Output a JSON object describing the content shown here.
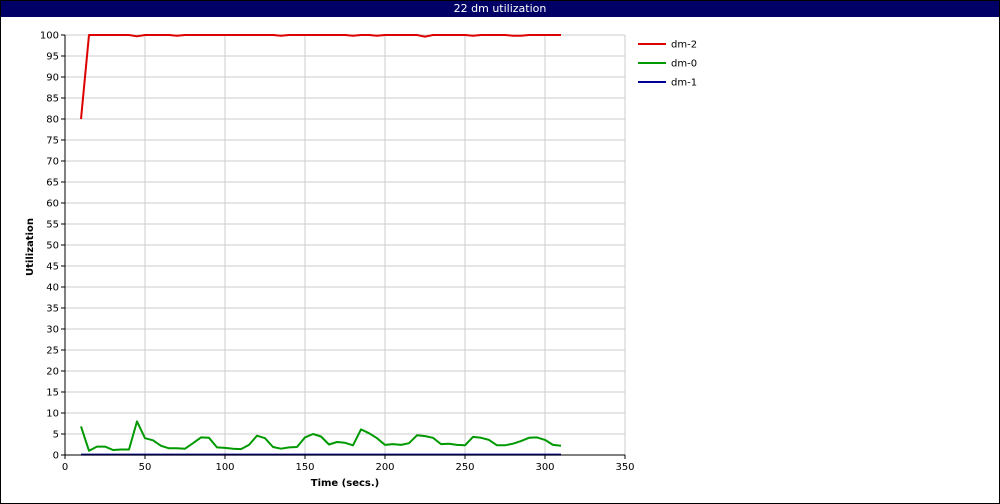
{
  "window": {
    "title": "22 dm utilization"
  },
  "chart_data": {
    "type": "line",
    "title": "22 dm utilization",
    "xlabel": "Time (secs.)",
    "ylabel": "Utilization",
    "xlim": [
      0,
      350
    ],
    "ylim": [
      0,
      100
    ],
    "xticks": [
      0,
      50,
      100,
      150,
      200,
      250,
      300,
      350
    ],
    "yticks": [
      0,
      5,
      10,
      15,
      20,
      25,
      30,
      35,
      40,
      45,
      50,
      55,
      60,
      65,
      70,
      75,
      80,
      85,
      90,
      95,
      100
    ],
    "grid": true,
    "legend_position": "right",
    "series": [
      {
        "name": "dm-2",
        "color": "#dd0000",
        "x": [
          10,
          15,
          20,
          25,
          30,
          35,
          40,
          45,
          50,
          55,
          60,
          65,
          70,
          75,
          80,
          85,
          90,
          95,
          100,
          105,
          110,
          115,
          120,
          125,
          130,
          135,
          140,
          145,
          150,
          155,
          160,
          165,
          170,
          175,
          180,
          185,
          190,
          195,
          200,
          205,
          210,
          215,
          220,
          225,
          230,
          235,
          240,
          245,
          250,
          255,
          260,
          265,
          270,
          275,
          280,
          285,
          290,
          295,
          300,
          305,
          310
        ],
        "y": [
          80,
          100,
          100,
          100,
          100,
          100,
          100,
          99.7,
          100,
          100,
          100,
          100,
          99.8,
          100,
          100,
          100,
          100,
          100,
          100,
          100,
          100,
          100,
          100,
          100,
          100,
          99.8,
          100,
          100,
          100,
          100,
          100,
          100,
          100,
          100,
          99.8,
          100,
          100,
          99.8,
          100,
          100,
          100,
          100,
          100,
          99.6,
          100,
          100,
          100,
          100,
          100,
          99.8,
          100,
          100,
          100,
          100,
          99.8,
          99.8,
          100,
          100,
          100,
          100,
          100
        ]
      },
      {
        "name": "dm-0",
        "color": "#009900",
        "x": [
          10,
          15,
          20,
          25,
          30,
          35,
          40,
          45,
          50,
          55,
          60,
          65,
          70,
          75,
          80,
          85,
          90,
          95,
          100,
          105,
          110,
          115,
          120,
          125,
          130,
          135,
          140,
          145,
          150,
          155,
          160,
          165,
          170,
          175,
          180,
          185,
          190,
          195,
          200,
          205,
          210,
          215,
          220,
          225,
          230,
          235,
          240,
          245,
          250,
          255,
          260,
          265,
          270,
          275,
          280,
          285,
          290,
          295,
          300,
          305,
          310
        ],
        "y": [
          6.8,
          1.0,
          2.0,
          2.0,
          1.2,
          1.3,
          1.3,
          8.0,
          4.0,
          3.5,
          2.2,
          1.6,
          1.6,
          1.5,
          2.8,
          4.2,
          4.1,
          1.8,
          1.7,
          1.5,
          1.4,
          2.4,
          4.6,
          4.0,
          1.9,
          1.5,
          1.8,
          1.9,
          4.2,
          5.0,
          4.4,
          2.5,
          3.1,
          2.9,
          2.3,
          6.1,
          5.2,
          4.0,
          2.4,
          2.6,
          2.4,
          2.8,
          4.7,
          4.5,
          4.1,
          2.6,
          2.7,
          2.4,
          2.3,
          4.3,
          4.1,
          3.6,
          2.3,
          2.3,
          2.7,
          3.3,
          4.1,
          4.2,
          3.6,
          2.4,
          2.2
        ]
      },
      {
        "name": "dm-1",
        "color": "#000099",
        "x": [
          10,
          50,
          100,
          150,
          200,
          250,
          300,
          310
        ],
        "y": [
          0.1,
          0.1,
          0.1,
          0.1,
          0.1,
          0.1,
          0.1,
          0.1
        ]
      }
    ]
  }
}
